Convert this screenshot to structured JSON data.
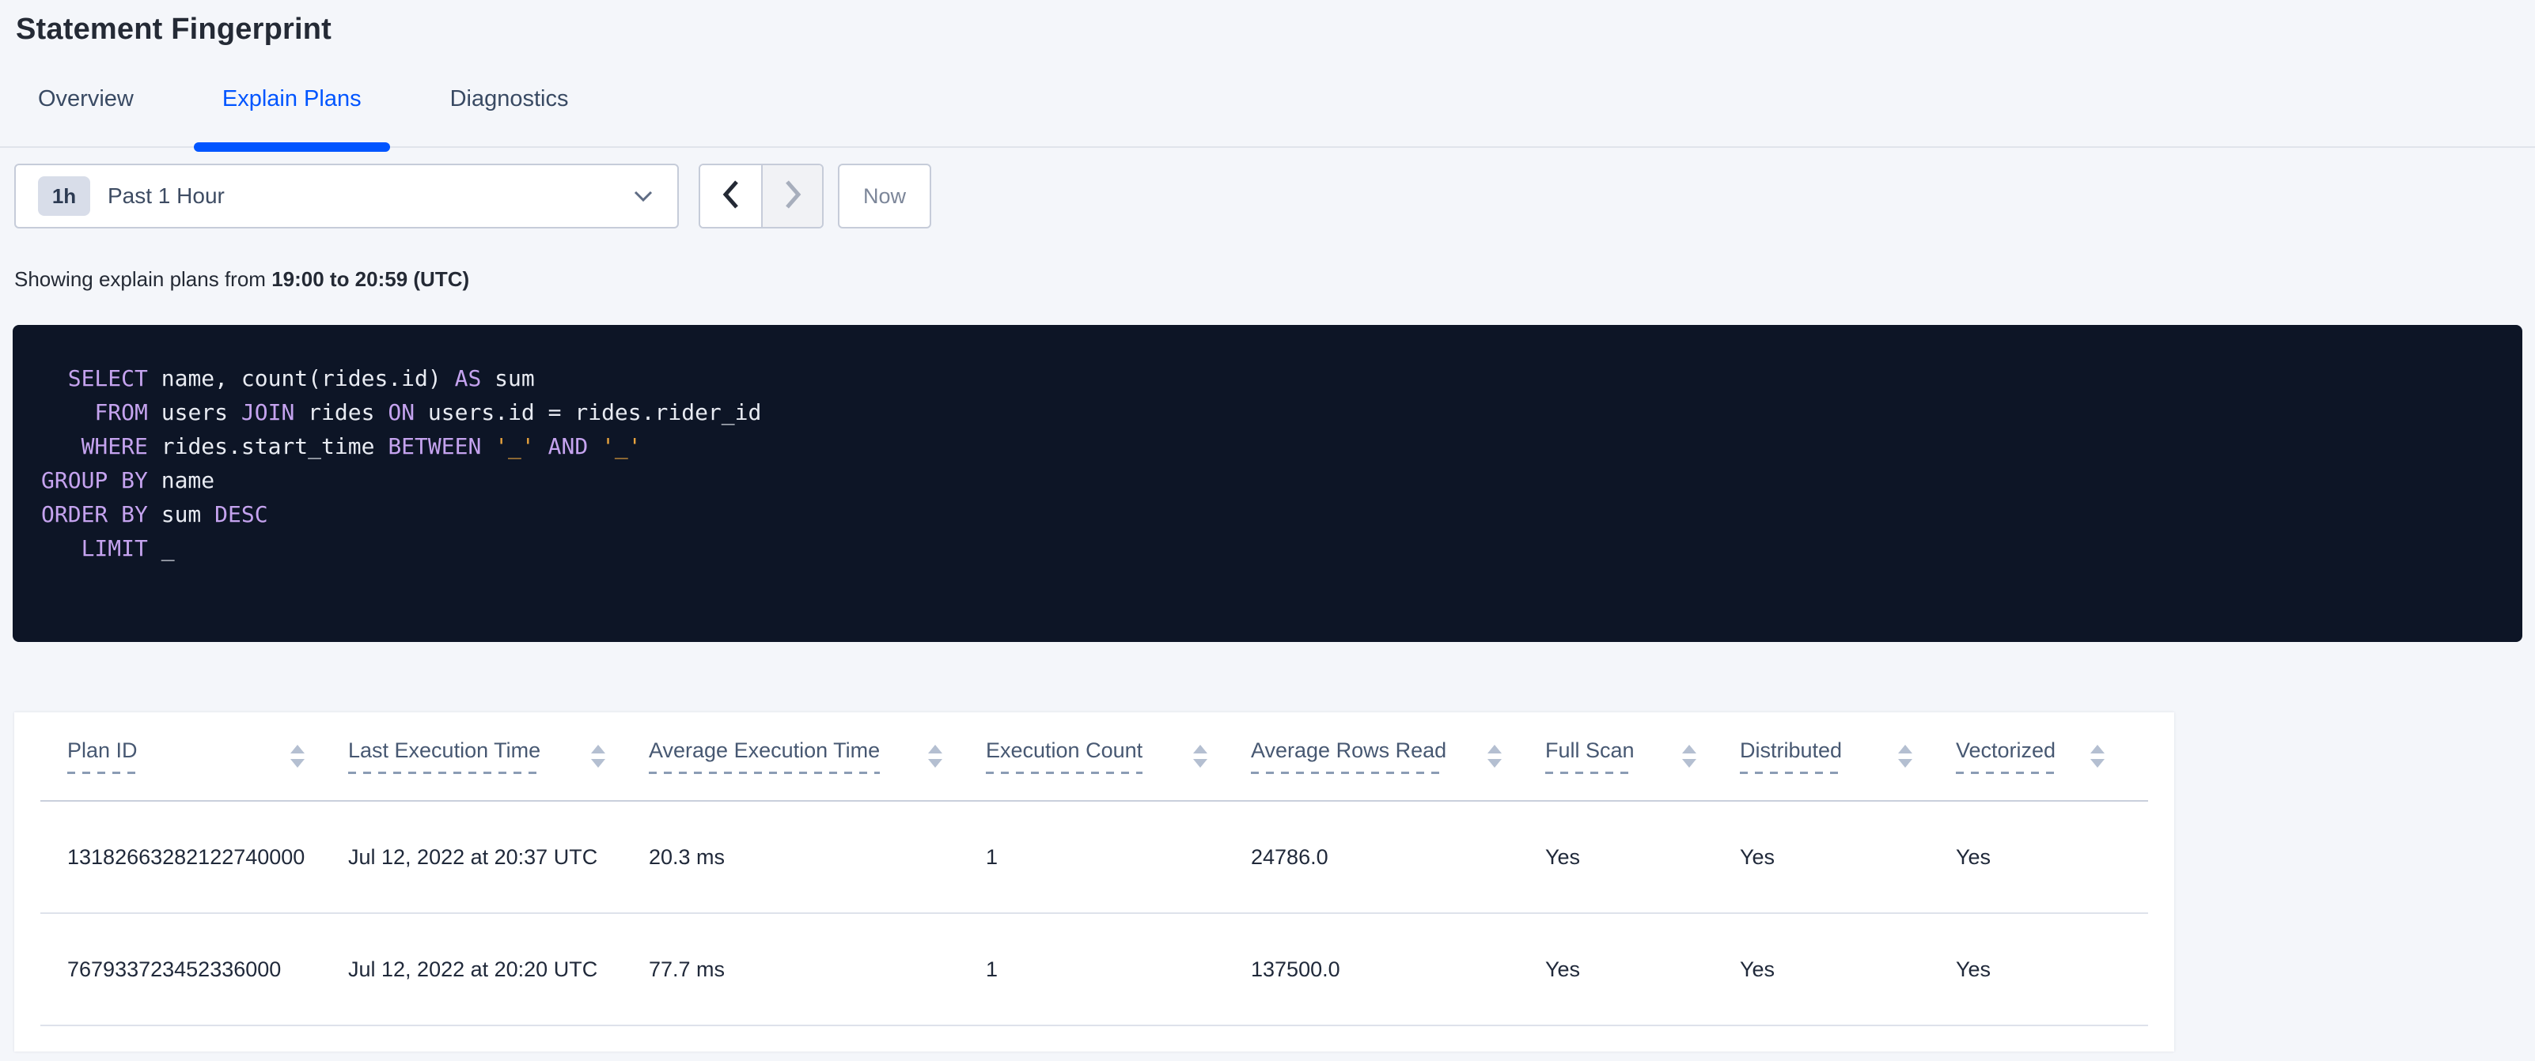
{
  "page": {
    "title": "Statement Fingerprint"
  },
  "tabs": [
    {
      "label": "Overview"
    },
    {
      "label": "Explain Plans"
    },
    {
      "label": "Diagnostics"
    }
  ],
  "time_picker": {
    "badge": "1h",
    "selected": "Past 1 Hour",
    "now_label": "Now",
    "icons": {
      "dropdown": "chevron-down",
      "prev": "chevron-left",
      "next": "chevron-right"
    }
  },
  "subtitle": {
    "prefix": "Showing explain plans from ",
    "range": "19:00 to 20:59 (UTC)"
  },
  "sql": {
    "lines": [
      [
        {
          "c": "txt",
          "s": "  "
        },
        {
          "c": "kw",
          "s": "SELECT"
        },
        {
          "c": "txt",
          "s": " name, count(rides.id) "
        },
        {
          "c": "kw",
          "s": "AS"
        },
        {
          "c": "txt",
          "s": " sum"
        }
      ],
      [
        {
          "c": "txt",
          "s": "    "
        },
        {
          "c": "kw",
          "s": "FROM"
        },
        {
          "c": "txt",
          "s": " users "
        },
        {
          "c": "kw",
          "s": "JOIN"
        },
        {
          "c": "txt",
          "s": " rides "
        },
        {
          "c": "kw",
          "s": "ON"
        },
        {
          "c": "txt",
          "s": " users.id = rides.rider_id"
        }
      ],
      [
        {
          "c": "txt",
          "s": "   "
        },
        {
          "c": "kw",
          "s": "WHERE"
        },
        {
          "c": "txt",
          "s": " rides.start_time "
        },
        {
          "c": "kw",
          "s": "BETWEEN"
        },
        {
          "c": "txt",
          "s": " "
        },
        {
          "c": "lit",
          "s": "'_'"
        },
        {
          "c": "txt",
          "s": " "
        },
        {
          "c": "kw",
          "s": "AND"
        },
        {
          "c": "txt",
          "s": " "
        },
        {
          "c": "lit",
          "s": "'_'"
        }
      ],
      [
        {
          "c": "kw",
          "s": "GROUP BY"
        },
        {
          "c": "txt",
          "s": " name"
        }
      ],
      [
        {
          "c": "kw",
          "s": "ORDER BY"
        },
        {
          "c": "txt",
          "s": " sum "
        },
        {
          "c": "kw",
          "s": "DESC"
        }
      ],
      [
        {
          "c": "txt",
          "s": "   "
        },
        {
          "c": "kw",
          "s": "LIMIT"
        },
        {
          "c": "txt",
          "s": " _"
        }
      ]
    ]
  },
  "table": {
    "columns": [
      "Plan ID",
      "Last Execution Time",
      "Average Execution Time",
      "Execution Count",
      "Average Rows Read",
      "Full Scan",
      "Distributed",
      "Vectorized"
    ],
    "rows": [
      [
        "13182663282122740000",
        "Jul 12, 2022 at 20:37 UTC",
        "20.3 ms",
        "1",
        "24786.0",
        "Yes",
        "Yes",
        "Yes"
      ],
      [
        "767933723452336000",
        "Jul 12, 2022 at 20:20 UTC",
        "77.7 ms",
        "1",
        "137500.0",
        "Yes",
        "Yes",
        "Yes"
      ]
    ],
    "sort_icon": "sort-arrows"
  },
  "colors": {
    "accent_blue": "#0055ff",
    "page_background": "#f4f6fa",
    "code_background": "#0d1526",
    "code_keyword": "#c5a3ef",
    "code_literal": "#e8a33d",
    "code_text": "#e8ebf2",
    "header_text": "#475872",
    "cell_text": "#20293a"
  }
}
